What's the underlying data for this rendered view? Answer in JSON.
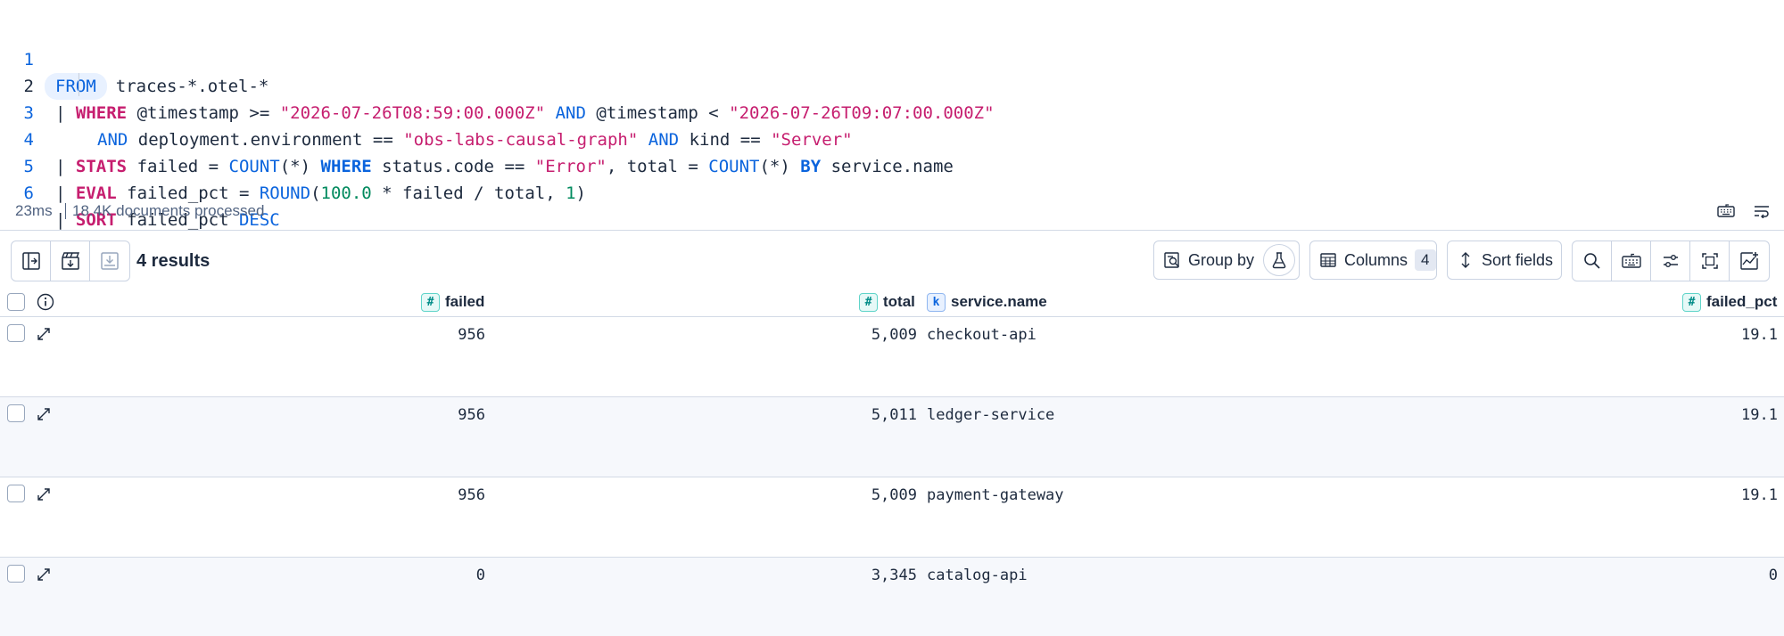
{
  "editor": {
    "lines": [
      {
        "n": "1"
      },
      {
        "n": "2"
      },
      {
        "n": "3"
      },
      {
        "n": "4"
      },
      {
        "n": "5"
      },
      {
        "n": "6"
      }
    ],
    "l1": {
      "from": "FROM",
      "source": "traces-*.otel-*"
    },
    "l2": {
      "pipe": "|",
      "where": "WHERE",
      "a": "@timestamp >=",
      "s1": "\"2026-07-26T08:59:00.000Z\"",
      "and": "AND",
      "b": "@timestamp <",
      "s2": "\"2026-07-26T09:07:00.000Z\""
    },
    "l3": {
      "and": "AND",
      "a": "deployment.environment ==",
      "s1": "\"obs-labs-causal-graph\"",
      "and2": "AND",
      "b": "kind ==",
      "s2": "\"Server\""
    },
    "l4": {
      "pipe": "|",
      "stats": "STATS",
      "a": "failed =",
      "count": "COUNT",
      "star": "(*)",
      "where": "WHERE",
      "b": "status.code ==",
      "s1": "\"Error\"",
      "c": ", total =",
      "count2": "COUNT",
      "star2": "(*)",
      "by": "BY",
      "d": "service.name"
    },
    "l5": {
      "pipe": "|",
      "eval": "EVAL",
      "a": "failed_pct =",
      "round": "ROUND",
      "p1": "(",
      "n1": "100.0",
      "b": "* failed / total,",
      "n2": "1",
      "p2": ")"
    },
    "l6": {
      "pipe": "|",
      "sort": "SORT",
      "a": "failed_pct",
      "desc": "DESC"
    }
  },
  "status": {
    "time": "23ms",
    "docs": "18.4K documents processed",
    "keyboard_icon": "keyboard-icon",
    "wrap_icon": "word-wrap-icon"
  },
  "toolbar": {
    "results": "4 results",
    "group_by": "Group by",
    "columns": "Columns",
    "columns_count": "4",
    "sort_fields": "Sort fields"
  },
  "table": {
    "headers": {
      "failed": "failed",
      "total": "total",
      "service": "service.name",
      "failed_pct": "failed_pct"
    },
    "type_badges": {
      "num": "#",
      "kw": "k"
    },
    "rows": [
      {
        "failed": "956",
        "total": "5,009",
        "service": "checkout-api",
        "failed_pct": "19.1"
      },
      {
        "failed": "956",
        "total": "5,011",
        "service": "ledger-service",
        "failed_pct": "19.1"
      },
      {
        "failed": "956",
        "total": "5,009",
        "service": "payment-gateway",
        "failed_pct": "19.1"
      },
      {
        "failed": "0",
        "total": "3,345",
        "service": "catalog-api",
        "failed_pct": "0"
      }
    ]
  },
  "colors": {
    "keyword": "#c61e6f",
    "function": "#0b64dd",
    "string": "#c61e6f",
    "number": "#008a5e",
    "border": "#d3dae6"
  }
}
